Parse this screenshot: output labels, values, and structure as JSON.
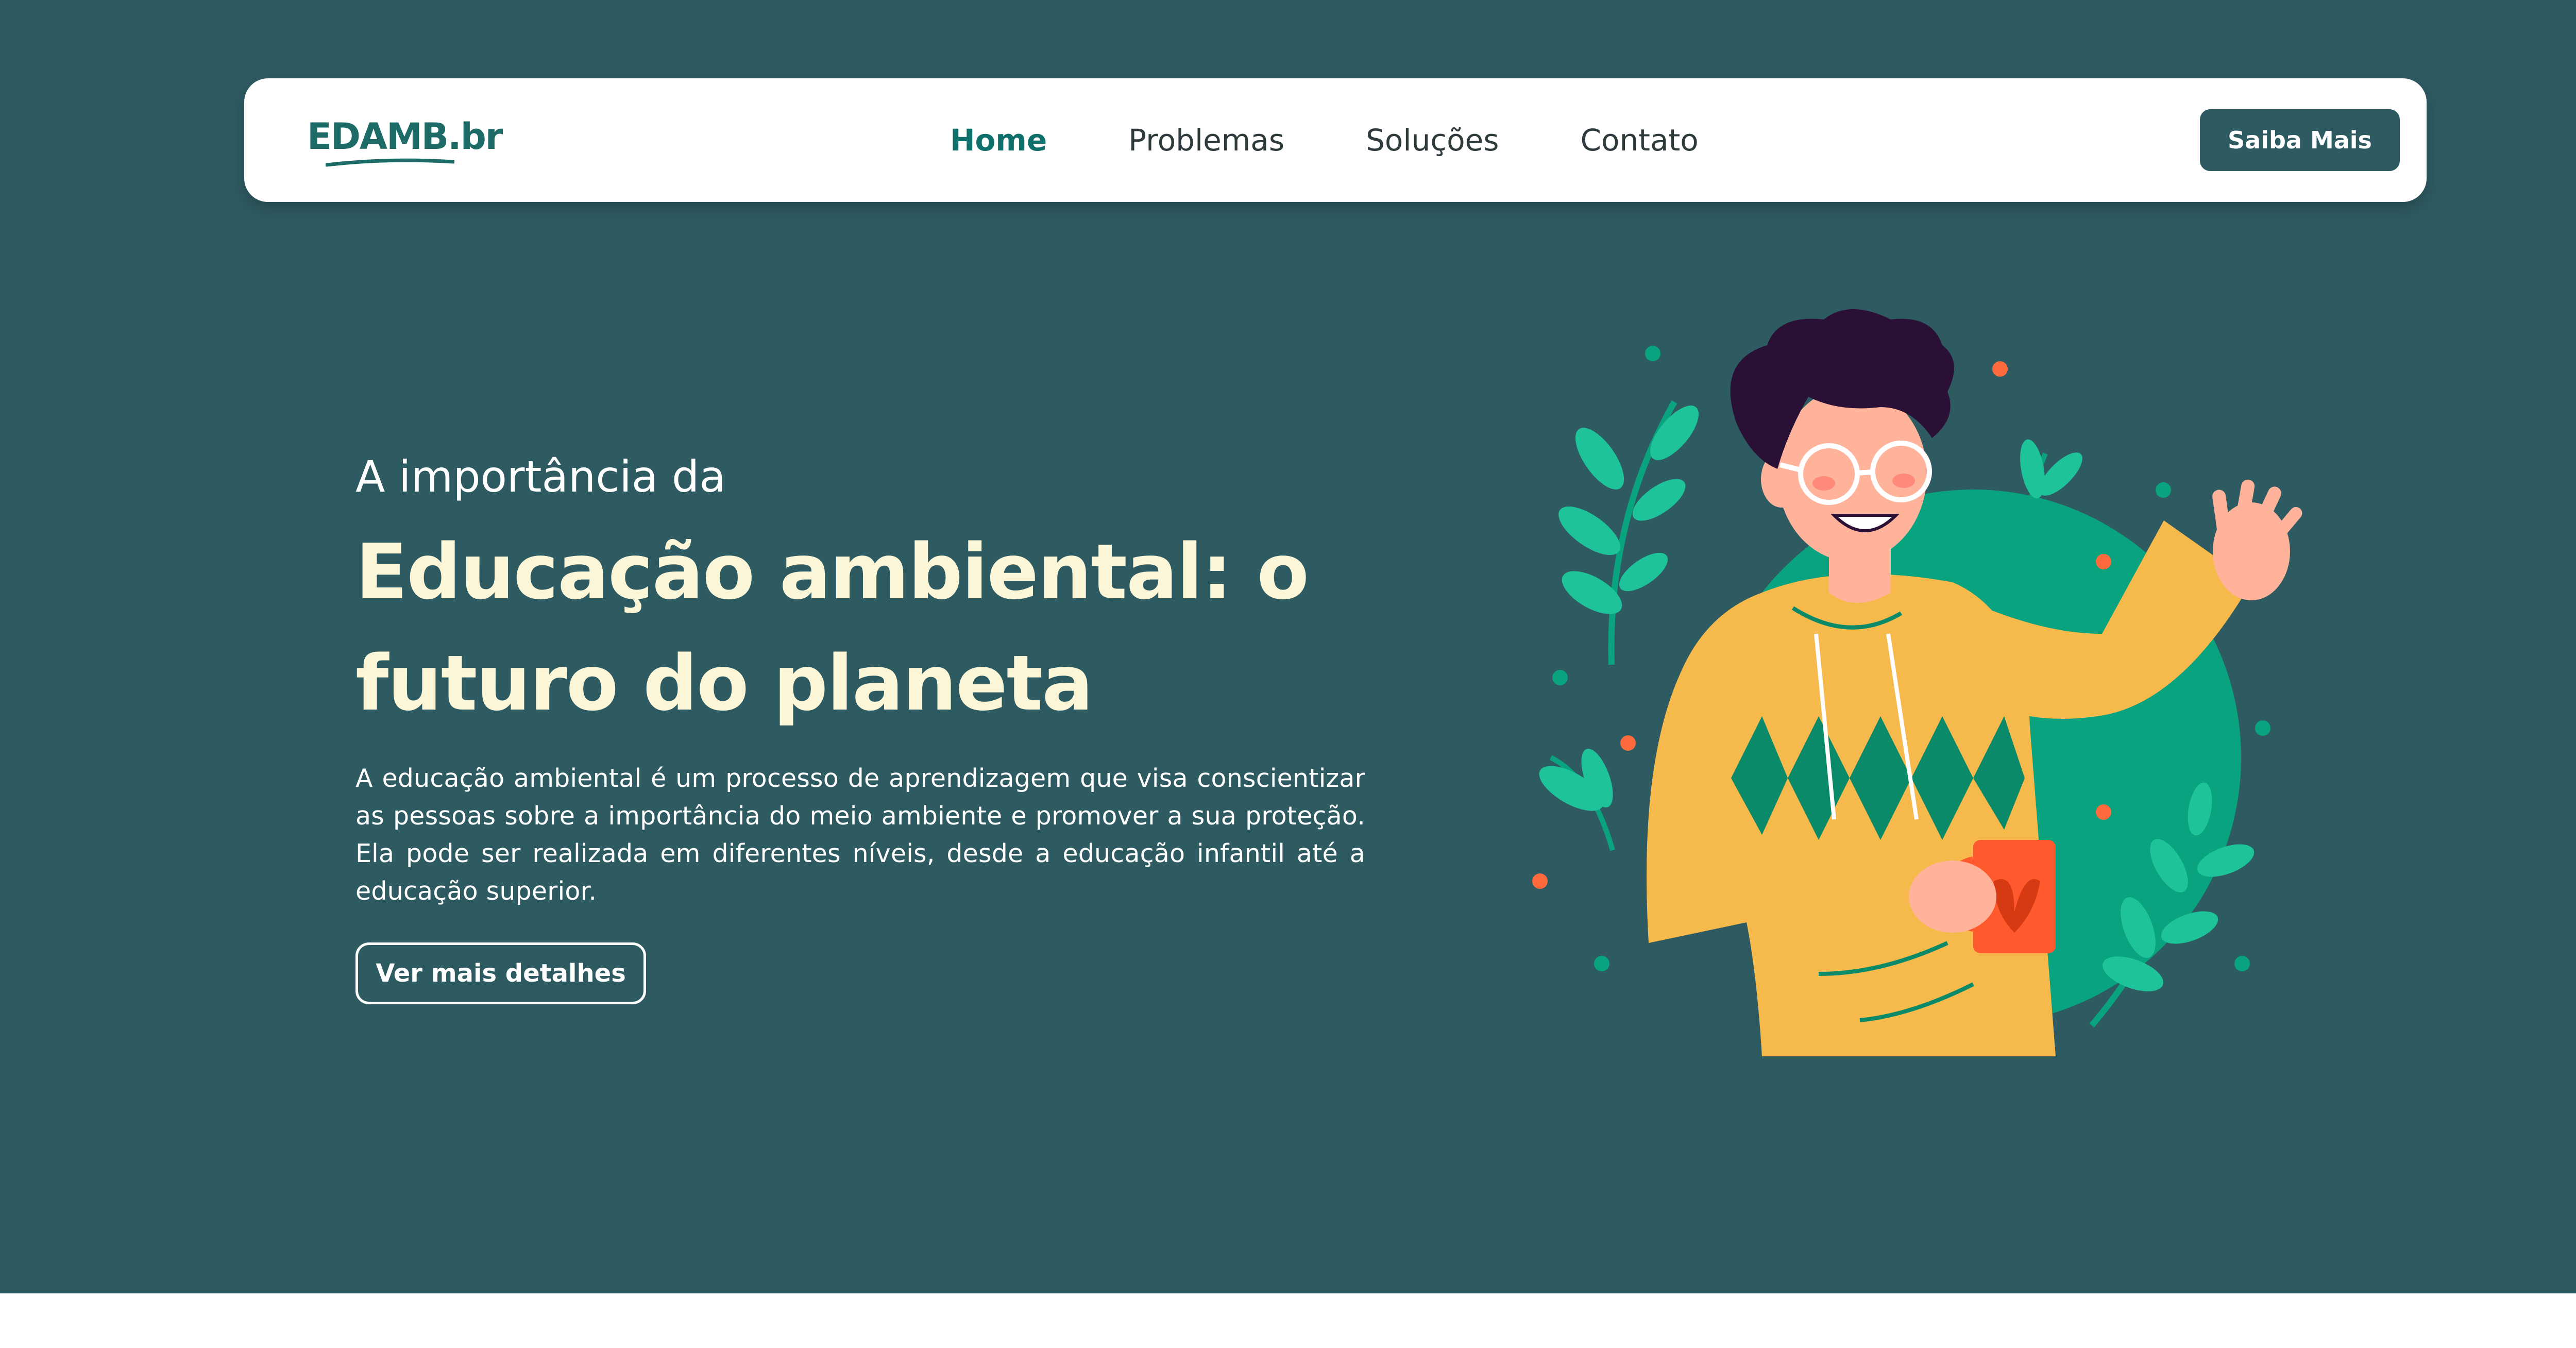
{
  "colors": {
    "hero_background": "#2e5a61",
    "accent": "#0f6f6a",
    "headline": "#fbf6d8",
    "primary_button": "#2e5a61"
  },
  "navbar": {
    "logo": {
      "text": "EDAMB.br",
      "icon": "recycle-bin-icon"
    },
    "links": [
      {
        "label": "Home",
        "active": true
      },
      {
        "label": "Problemas",
        "active": false
      },
      {
        "label": "Soluções",
        "active": false
      },
      {
        "label": "Contato",
        "active": false
      }
    ],
    "cta_label": "Saiba Mais"
  },
  "hero": {
    "kicker": "A importância da",
    "headline": "Educação ambiental: o futuro do planeta",
    "paragraph": "A educação ambiental é um processo de aprendizagem que visa conscientizar as pessoas sobre a importância do meio ambiente e promover a sua proteção. Ela pode ser realizada em diferentes níveis, desde a educação infantil até a educação superior.",
    "button_label": "Ver mais detalhes",
    "illustration": "waving-person-with-mug-illustration"
  }
}
